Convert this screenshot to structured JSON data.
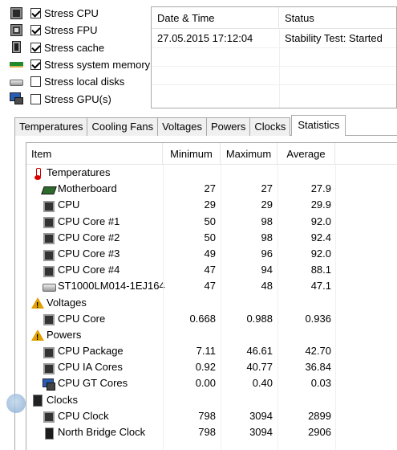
{
  "stress_options": [
    {
      "label": "Stress CPU",
      "checked": true,
      "icon": "cpu-chip-icon"
    },
    {
      "label": "Stress FPU",
      "checked": true,
      "icon": "fpu-chip-icon"
    },
    {
      "label": "Stress cache",
      "checked": true,
      "icon": "cache-chip-icon"
    },
    {
      "label": "Stress system memory",
      "checked": true,
      "icon": "memory-module-icon"
    },
    {
      "label": "Stress local disks",
      "checked": false,
      "icon": "hard-disk-icon"
    },
    {
      "label": "Stress GPU(s)",
      "checked": false,
      "icon": "gpu-monitor-icon"
    }
  ],
  "log": {
    "headers": {
      "datetime": "Date & Time",
      "status": "Status"
    },
    "rows": [
      {
        "datetime": "27.05.2015 17:12:04",
        "status": "Stability Test: Started"
      }
    ]
  },
  "tabs": [
    "Temperatures",
    "Cooling Fans",
    "Voltages",
    "Powers",
    "Clocks",
    "Statistics"
  ],
  "active_tab": "Statistics",
  "stats": {
    "headers": {
      "item": "Item",
      "min": "Minimum",
      "max": "Maximum",
      "avg": "Average"
    },
    "rows": [
      {
        "label": "Temperatures",
        "group": true,
        "icon": "thermometer-icon"
      },
      {
        "label": "Motherboard",
        "min": "27",
        "max": "27",
        "avg": "27.9",
        "icon": "motherboard-icon"
      },
      {
        "label": "CPU",
        "min": "29",
        "max": "29",
        "avg": "29.9",
        "icon": "cpu-icon"
      },
      {
        "label": "CPU Core #1",
        "min": "50",
        "max": "98",
        "avg": "92.0",
        "icon": "cpu-icon"
      },
      {
        "label": "CPU Core #2",
        "min": "50",
        "max": "98",
        "avg": "92.4",
        "icon": "cpu-icon"
      },
      {
        "label": "CPU Core #3",
        "min": "49",
        "max": "96",
        "avg": "92.0",
        "icon": "cpu-icon"
      },
      {
        "label": "CPU Core #4",
        "min": "47",
        "max": "94",
        "avg": "88.1",
        "icon": "cpu-icon"
      },
      {
        "label": "ST1000LM014-1EJ164",
        "min": "47",
        "max": "48",
        "avg": "47.1",
        "icon": "hard-disk-icon"
      },
      {
        "label": "Voltages",
        "group": true,
        "icon": "warning-icon"
      },
      {
        "label": "CPU Core",
        "min": "0.668",
        "max": "0.988",
        "avg": "0.936",
        "icon": "cpu-icon"
      },
      {
        "label": "Powers",
        "group": true,
        "icon": "warning-icon"
      },
      {
        "label": "CPU Package",
        "min": "7.11",
        "max": "46.61",
        "avg": "42.70",
        "icon": "cpu-icon"
      },
      {
        "label": "CPU IA Cores",
        "min": "0.92",
        "max": "40.77",
        "avg": "36.84",
        "icon": "cpu-icon"
      },
      {
        "label": "CPU GT Cores",
        "min": "0.00",
        "max": "0.40",
        "avg": "0.03",
        "icon": "gpu-icon"
      },
      {
        "label": "Clocks",
        "group": true,
        "icon": "clock-chip-icon"
      },
      {
        "label": "CPU Clock",
        "min": "798",
        "max": "3094",
        "avg": "2899",
        "icon": "cpu-icon"
      },
      {
        "label": "North Bridge Clock",
        "min": "798",
        "max": "3094",
        "avg": "2906",
        "icon": "northbridge-icon"
      }
    ]
  }
}
